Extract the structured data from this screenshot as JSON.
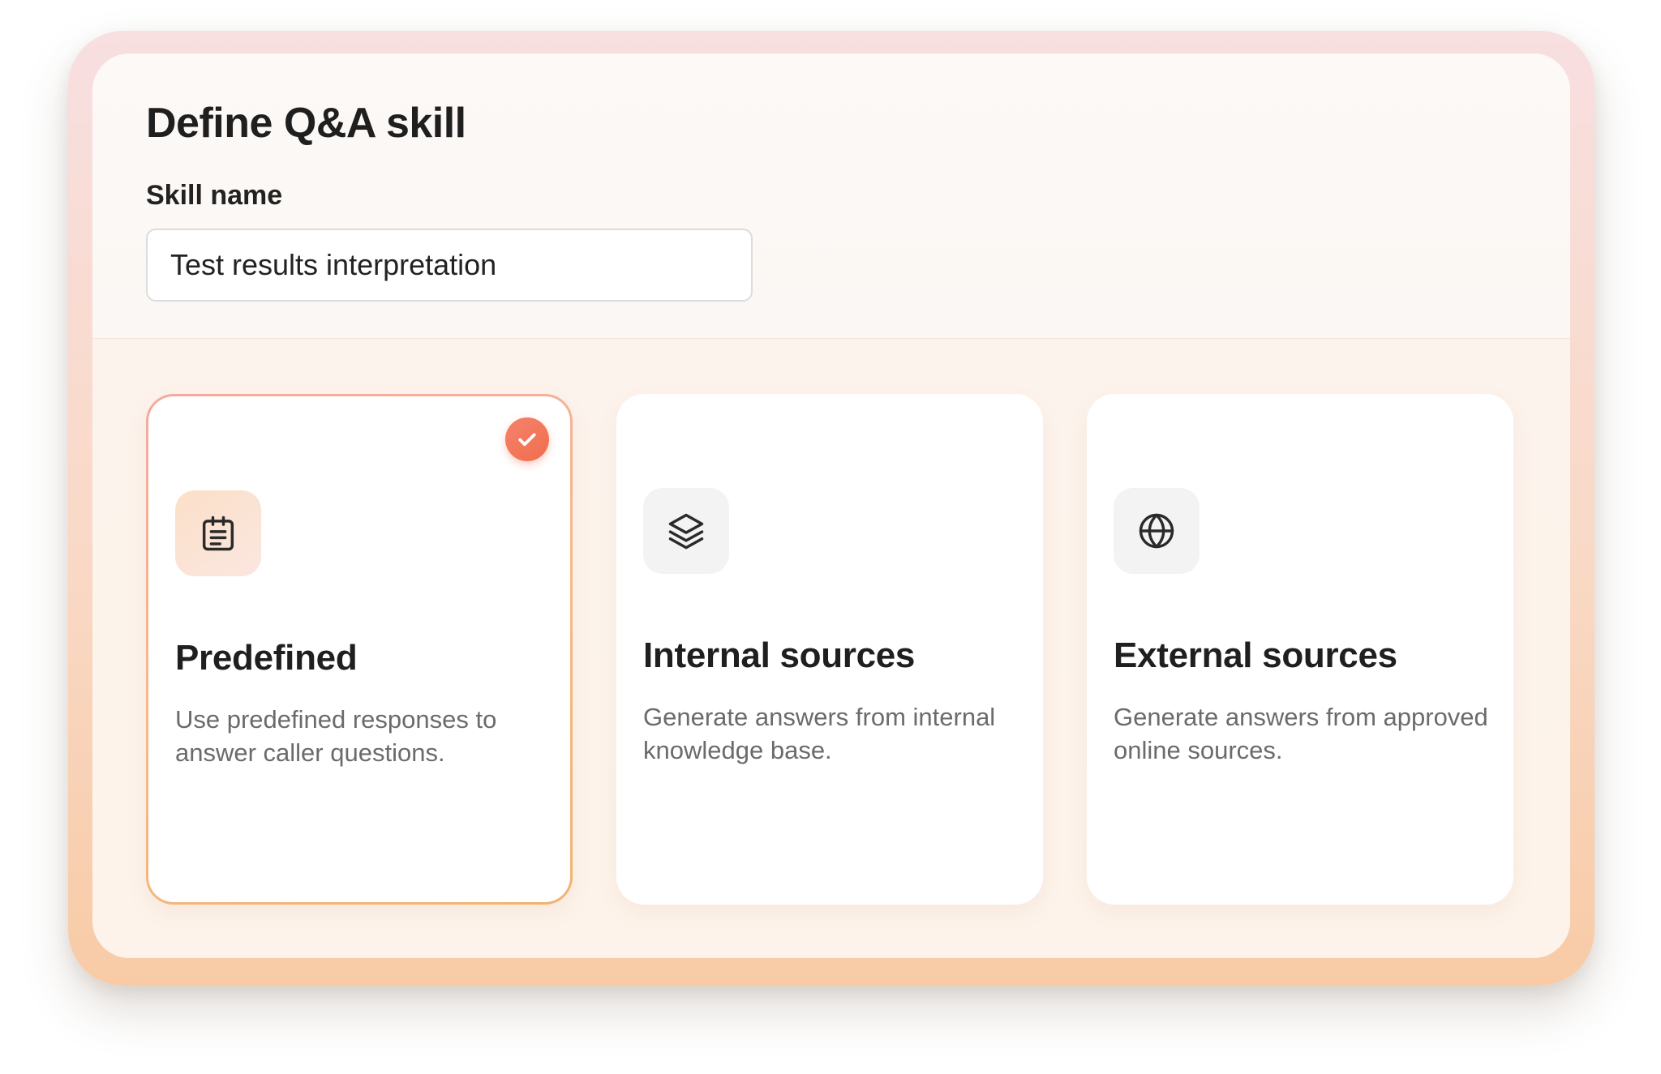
{
  "page": {
    "title": "Define Q&A skill"
  },
  "skill_name": {
    "label": "Skill name",
    "value": "Test results interpretation"
  },
  "options": [
    {
      "title": "Predefined",
      "description": "Use predefined responses to answer caller questions.",
      "icon": "clipboard-list-icon",
      "selected": true
    },
    {
      "title": "Internal sources",
      "description": "Generate answers from internal knowledge base.",
      "icon": "layers-icon",
      "selected": false
    },
    {
      "title": "External sources",
      "description": "Generate answers from approved online sources.",
      "icon": "globe-icon",
      "selected": false
    }
  ],
  "colors": {
    "accent": "#f26d4d",
    "text_primary": "#1f1f1f",
    "text_secondary": "#6b6b6b"
  }
}
